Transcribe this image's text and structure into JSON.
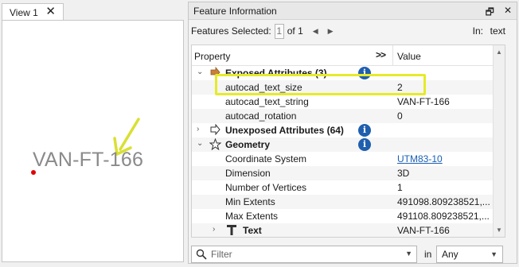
{
  "view": {
    "tab_label": "View 1",
    "close_glyph": "✕",
    "feature_text": "VAN-FT-166",
    "annotation_color": "#d9e032",
    "point_color": "#e00000"
  },
  "feature_info": {
    "title": "Feature Information",
    "title_buttons": {
      "float": "🗗",
      "close": "✕"
    },
    "toolbar": {
      "selected_label": "Features Selected:",
      "selected_value": "1",
      "of_label": "of 1",
      "prev": "◀",
      "next": "▶",
      "in_label": "In:",
      "in_value": "text"
    },
    "columns": {
      "property": "Property",
      "expand": ">>",
      "value": "Value"
    },
    "rows": [
      {
        "label": "Exposed Attributes (3)",
        "value": "",
        "expanded": true,
        "icon": "exposed-attributes-icon"
      },
      {
        "label": "autocad_text_size",
        "value": "2"
      },
      {
        "label": "autocad_text_string",
        "value": "VAN-FT-166"
      },
      {
        "label": "autocad_rotation",
        "value": "0"
      },
      {
        "label": "Unexposed Attributes (64)",
        "value": "",
        "expanded": false,
        "icon": "unexposed-attributes-icon"
      },
      {
        "label": "Geometry",
        "value": "",
        "expanded": true,
        "icon": "geometry-icon"
      },
      {
        "label": "Coordinate System",
        "value": "UTM83-10"
      },
      {
        "label": "Dimension",
        "value": "3D"
      },
      {
        "label": "Number of Vertices",
        "value": "1"
      },
      {
        "label": "Min Extents",
        "value": "491098.809238521,..."
      },
      {
        "label": "Max Extents",
        "value": "491108.809238521,..."
      },
      {
        "label": "Text",
        "value": "VAN-FT-166",
        "expanded": false,
        "icon": "text-icon"
      }
    ],
    "info_glyph": "i",
    "highlight_color": "#e6ea2a",
    "filter": {
      "placeholder": "Filter",
      "in_label": "in",
      "scope_value": "Any"
    }
  }
}
